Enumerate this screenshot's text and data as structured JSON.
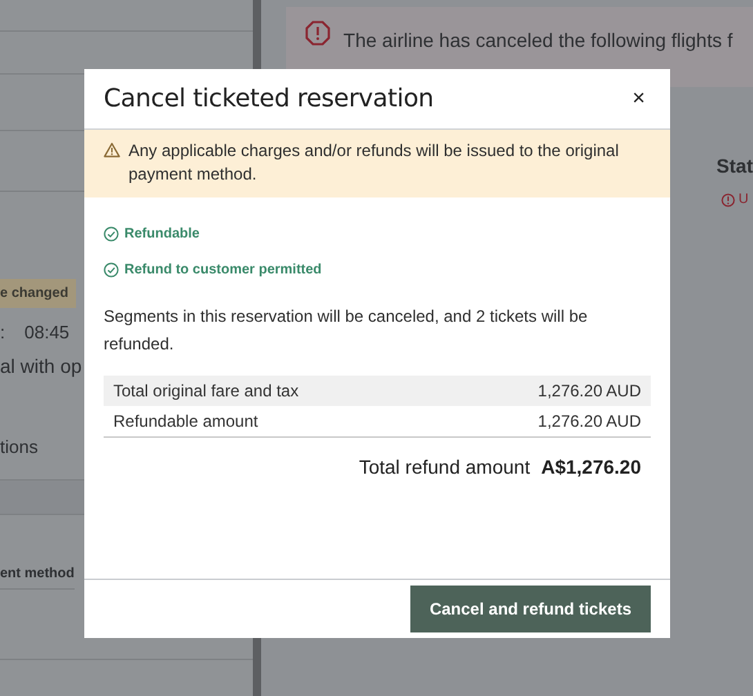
{
  "background": {
    "alert": {
      "lines": [
        "The airline has canceled the following flights f"
      ]
    },
    "status_header": "Stat",
    "status_value": "U",
    "left": {
      "badge": "e changed",
      "time_prefix": ":",
      "time": "08:45",
      "line": "al with op",
      "option": "tions",
      "payment_header": "ent method"
    }
  },
  "modal": {
    "title": "Cancel ticketed reservation",
    "close": "×",
    "warning": "Any applicable charges and/or refunds will be issued to the original payment method.",
    "checks": [
      "Refundable",
      "Refund to customer permitted"
    ],
    "summary": "Segments in this reservation will be canceled, and 2 tickets will be refunded.",
    "rows": [
      {
        "label": "Total original fare and tax",
        "value": "1,276.20 AUD",
        "shaded": true
      },
      {
        "label": "Refundable amount",
        "value": "1,276.20 AUD",
        "shaded": false
      }
    ],
    "total": {
      "label": "Total refund amount",
      "value": "A$1,276.20"
    },
    "button": "Cancel and refund tickets"
  }
}
